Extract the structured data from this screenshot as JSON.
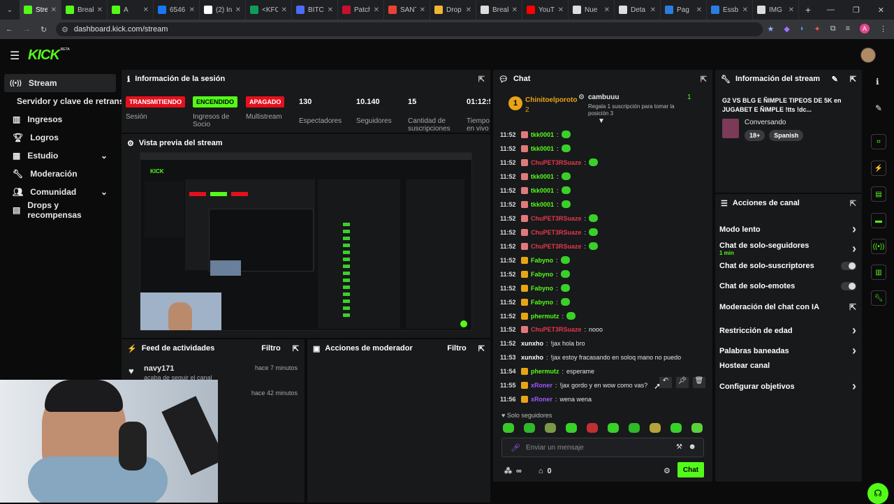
{
  "tabs": [
    {
      "label": "Strea",
      "fav": "#53fc18",
      "active": true
    },
    {
      "label": "Break",
      "fav": "#53fc18"
    },
    {
      "label": "A",
      "fav": "#53fc18"
    },
    {
      "label": "6546",
      "fav": "#1877f2"
    },
    {
      "label": "(2) In",
      "fav": "#ffffff"
    },
    {
      "label": "<KFC",
      "fav": "#0f9d58"
    },
    {
      "label": "BITC",
      "fav": "#4a6cf7"
    },
    {
      "label": "Patch",
      "fav": "#c8102e"
    },
    {
      "label": "SANT",
      "fav": "#ea4335"
    },
    {
      "label": "Drop",
      "fav": "#f2b632"
    },
    {
      "label": "Break",
      "fav": "#dddddd"
    },
    {
      "label": "YouT",
      "fav": "#ff0000"
    },
    {
      "label": "Nue",
      "fav": "#dddddd"
    },
    {
      "label": "Deta",
      "fav": "#dddddd"
    },
    {
      "label": "Pag",
      "fav": "#2a7de1"
    },
    {
      "label": "Essb",
      "fav": "#2a7de1"
    },
    {
      "label": "IMG",
      "fav": "#dddddd"
    }
  ],
  "browser": {
    "url": "dashboard.kick.com/stream",
    "avatar_letter": "A"
  },
  "header": {
    "logo": "KICK",
    "beta": "BETA"
  },
  "sidebar": {
    "items": [
      {
        "label": "Stream",
        "icon": "broadcast-icon"
      },
      {
        "label": "Servidor y clave de retransmisión"
      },
      {
        "label": "Ingresos",
        "icon": "chart-icon"
      },
      {
        "label": "Logros",
        "icon": "trophy-icon"
      },
      {
        "label": "Estudio",
        "icon": "grid-icon"
      },
      {
        "label": "Moderación",
        "icon": "wrench-icon"
      },
      {
        "label": "Comunidad",
        "icon": "users-icon"
      },
      {
        "label": "Drops y recompensas",
        "icon": "gift-icon"
      }
    ]
  },
  "session": {
    "title": "Información de la sesión",
    "badges": [
      {
        "text": "TRANSMITIENDO",
        "label": "Sesión",
        "bg": "#e5101d"
      },
      {
        "text": "ENCENDIDO",
        "label": "Ingresos de Socio",
        "bg": "#53fc18"
      },
      {
        "text": "APAGADO",
        "label": "Multistream",
        "bg": "#e5101d"
      }
    ],
    "stats": [
      {
        "value": "130",
        "label": "Espectadores"
      },
      {
        "value": "10.140",
        "label": "Seguidores"
      },
      {
        "value": "15",
        "label": "Cantidad de suscripciones"
      },
      {
        "value": "01:12:5",
        "label": "Tiempo en vivo"
      }
    ]
  },
  "preview": {
    "title": "Vista previa del stream"
  },
  "feed": {
    "title": "Feed de actividades",
    "filter": "Filtro",
    "items": [
      {
        "user": "navy171",
        "time": "hace 7 minutos",
        "desc": "acaba de seguir el canal"
      },
      {
        "user": "",
        "time": "hace 42 minutos",
        "desc": ""
      }
    ]
  },
  "modactions": {
    "title": "Acciones de moderador",
    "filter": "Filtro"
  },
  "chat": {
    "title": "Chat",
    "leader": {
      "name": "Chinitoelporoto",
      "count": "2",
      "rank": "1"
    },
    "gifter": {
      "name": "cambuuu",
      "count": "1",
      "desc": "Regala 1 suscripción para tomar la posición 3"
    },
    "messages": [
      {
        "time": "11:52",
        "user": "tkk0001",
        "color": "#53fc18",
        "text": ""
      },
      {
        "time": "11:52",
        "user": "tkk0001",
        "color": "#53fc18",
        "text": ""
      },
      {
        "time": "11:52",
        "user": "ChuPET3RSuaze",
        "color": "#e5374a",
        "text": ""
      },
      {
        "time": "11:52",
        "user": "tkk0001",
        "color": "#53fc18",
        "text": ""
      },
      {
        "time": "11:52",
        "user": "tkk0001",
        "color": "#53fc18",
        "text": ""
      },
      {
        "time": "11:52",
        "user": "tkk0001",
        "color": "#53fc18",
        "text": ""
      },
      {
        "time": "11:52",
        "user": "ChuPET3RSuaze",
        "color": "#e5374a",
        "text": ""
      },
      {
        "time": "11:52",
        "user": "ChuPET3RSuaze",
        "color": "#e5374a",
        "text": ""
      },
      {
        "time": "11:52",
        "user": "ChuPET3RSuaze",
        "color": "#e5374a",
        "text": ""
      },
      {
        "time": "11:52",
        "user": "Fabyno",
        "color": "#53fc18",
        "text": ""
      },
      {
        "time": "11:52",
        "user": "Fabyno",
        "color": "#53fc18",
        "text": ""
      },
      {
        "time": "11:52",
        "user": "Fabyno",
        "color": "#53fc18",
        "text": ""
      },
      {
        "time": "11:52",
        "user": "Fabyno",
        "color": "#53fc18",
        "text": ""
      },
      {
        "time": "11:52",
        "user": "phermutz",
        "color": "#53fc18",
        "text": ""
      },
      {
        "time": "11:52",
        "user": "ChuPET3RSuaze",
        "color": "#e5374a",
        "text": "nooo"
      },
      {
        "time": "11:52",
        "user": "xunxho",
        "color": "#ffffff",
        "text": "!jax hola bro"
      },
      {
        "time": "11:53",
        "user": "xunxho",
        "color": "#ffffff",
        "text": "!jax estoy fracasando en soloq mano no puedo"
      },
      {
        "time": "11:54",
        "user": "phermutz",
        "color": "#53fc18",
        "text": "esperame"
      },
      {
        "time": "11:55",
        "user": "xRoner",
        "color": "#9b59ff",
        "text": "!jax gordo y en wow como vas?"
      },
      {
        "time": "11:56",
        "user": "xRoner",
        "color": "#9b59ff",
        "text": "wena wena"
      }
    ],
    "mode": "Solo seguidores",
    "placeholder": "Enviar un mensaje",
    "viewers": "∞",
    "points": "0",
    "send": "Chat"
  },
  "streaminfo": {
    "title": "Información del stream",
    "stream_title": "G2 VS BLG E ÑIMPLE TIPEOS DE 5K en JUGABET E ÑIMPLE !tts !dc...",
    "category": "Conversando",
    "tags": [
      "18+",
      "Spanish"
    ]
  },
  "channel": {
    "title": "Acciones de canal",
    "items": [
      {
        "label": "Modo lento",
        "ctl": "chevron"
      },
      {
        "label": "Chat de solo-seguidores",
        "sub": "1 min",
        "ctl": "chevron"
      },
      {
        "label": "Chat de solo-suscriptores",
        "ctl": "toggle"
      },
      {
        "label": "Chat de solo-emotes",
        "ctl": "toggle"
      },
      {
        "label": "Moderación del chat con IA",
        "ctl": "link"
      },
      {
        "label": "Restricción de edad",
        "ctl": "chevron"
      },
      {
        "label": "Palabras baneadas",
        "ctl": "chevron"
      },
      {
        "label": "Hostear canal",
        "ctl": "none"
      },
      {
        "label": "Configurar objetivos",
        "ctl": "chevron"
      }
    ]
  },
  "colors": {
    "brand": "#53fc18",
    "live": "#e5101d",
    "panel": "#18191b"
  }
}
